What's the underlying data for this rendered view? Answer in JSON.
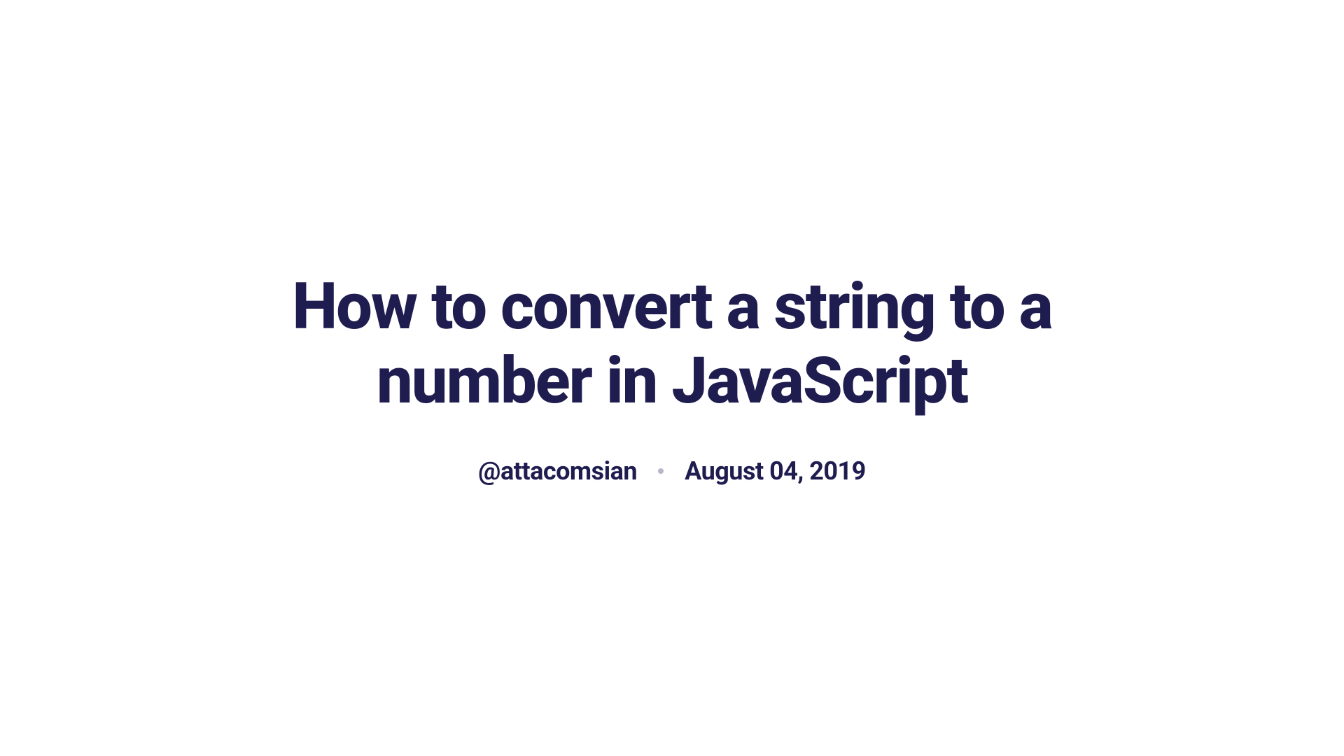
{
  "article": {
    "title": "How to convert a string to a number in JavaScript",
    "author": "@attacomsian",
    "date": "August 04, 2019"
  }
}
